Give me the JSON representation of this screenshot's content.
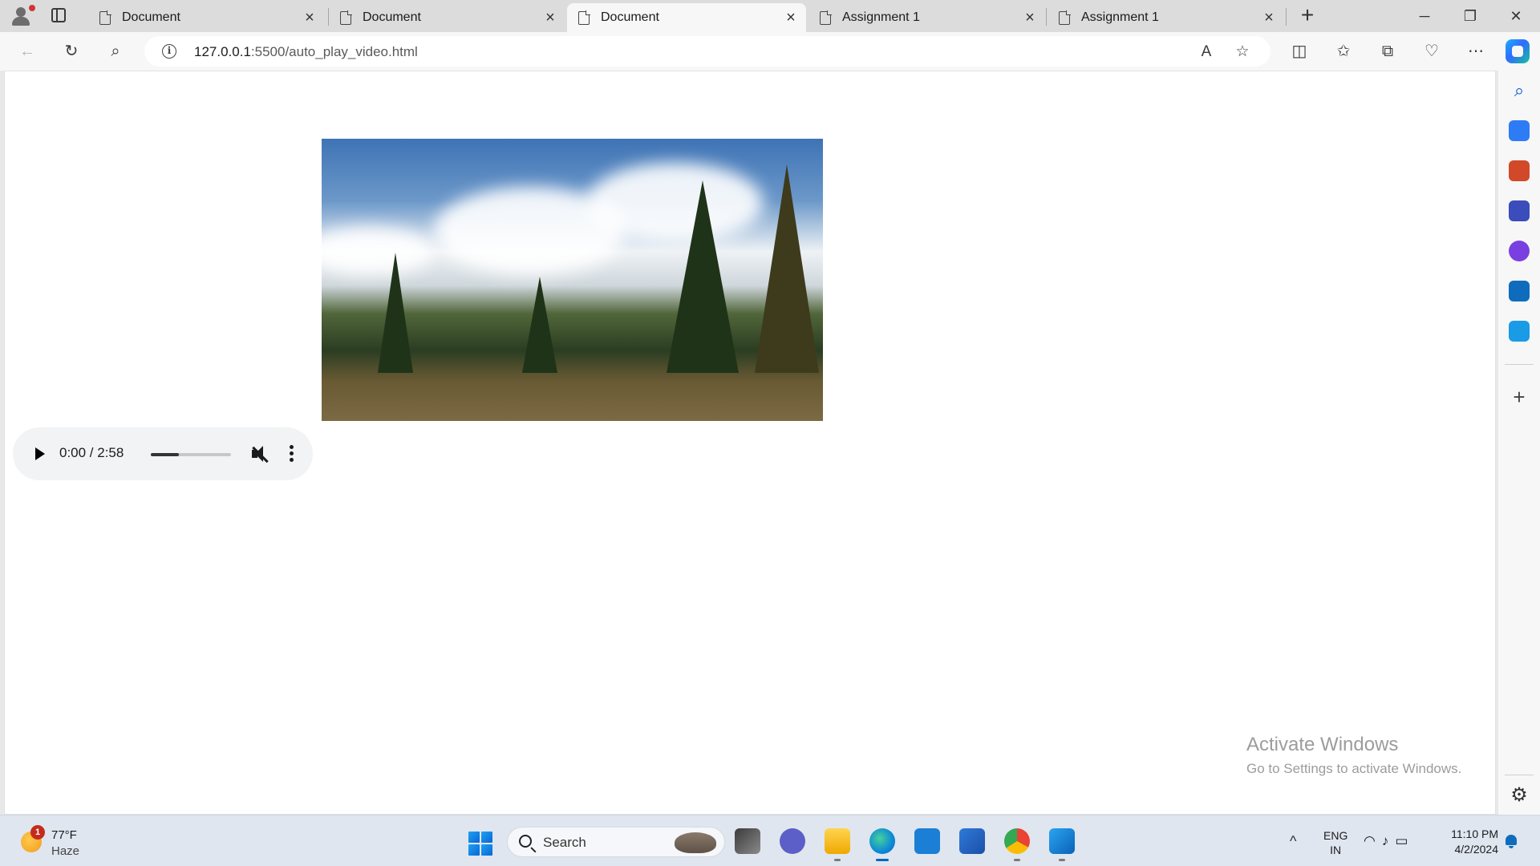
{
  "browser": {
    "tabs": [
      {
        "title": "Document",
        "active": false
      },
      {
        "title": "Document",
        "active": false
      },
      {
        "title": "Document",
        "active": true
      },
      {
        "title": "Assignment 1",
        "active": false
      },
      {
        "title": "Assignment 1",
        "active": false
      }
    ],
    "new_tab_symbol": "+",
    "window_controls": {
      "minimize": "─",
      "restore": "❐",
      "close": "✕"
    },
    "address": {
      "host": "127.0.0.1",
      "rest": ":5500/auto_play_video.html"
    },
    "toolbar_icons": [
      "back-icon",
      "refresh-icon",
      "search-icon",
      "read-aloud-icon",
      "favorite-star-icon",
      "split-screen-icon",
      "favorites-icon",
      "collections-icon",
      "browser-essentials-icon",
      "more-icon",
      "copilot-icon"
    ]
  },
  "page": {
    "video_description_icon": "landscape-video",
    "audio": {
      "time": "0:00 / 2:58",
      "volume_fraction": 0.35,
      "muted": true
    },
    "watermark": {
      "title": "Activate Windows",
      "subtitle": "Go to Settings to activate Windows."
    }
  },
  "sidebar": {
    "icons": [
      "search-icon",
      "shopping-tag-icon",
      "tools-icon",
      "games-icon",
      "microsoft-365-icon",
      "outlook-icon",
      "send-icon",
      "add-icon",
      "settings-icon"
    ],
    "colors": [
      "#0a5bd3",
      "#2d7cf6",
      "#d2492a",
      "#3a4dbb",
      "#7a3fe0",
      "#0f6cbd",
      "#1a9be6"
    ]
  },
  "taskbar": {
    "weather": {
      "badge": "1",
      "temp": "77°F",
      "condition": "Haze"
    },
    "search": {
      "label": "Search"
    },
    "apps": [
      "start-icon",
      "task-view-icon",
      "teams-chat-icon",
      "file-explorer-icon",
      "edge-icon",
      "mail-icon",
      "microsoft-store-icon",
      "chrome-icon",
      "vscode-icon"
    ],
    "tray": {
      "chevron": "^",
      "lang_line1": "ENG",
      "lang_line2": "IN",
      "time": "11:10 PM",
      "date": "4/2/2024"
    }
  }
}
